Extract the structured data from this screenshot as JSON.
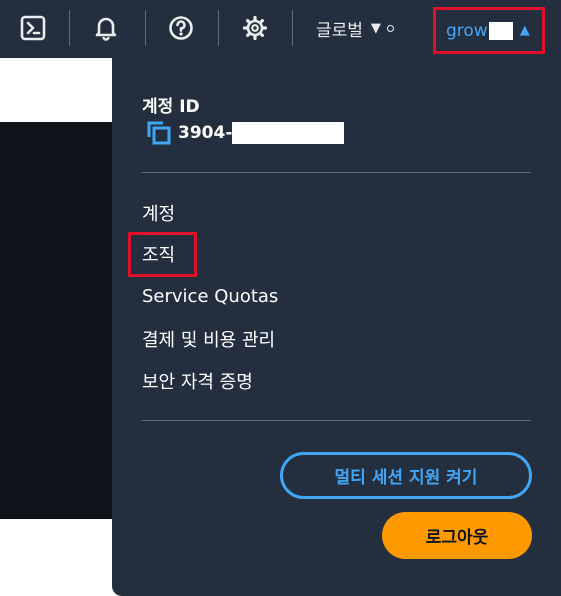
{
  "topnav": {
    "icons": [
      "cloudshell-icon",
      "bell-icon",
      "help-icon",
      "gear-icon"
    ],
    "region_label": "글로벌",
    "account_username": "grow"
  },
  "account_menu": {
    "id_heading": "계정 ID",
    "account_id_prefix": "3904-",
    "items": [
      "계정",
      "조직",
      "Service Quotas",
      "결제 및 비용 관리",
      "보안 자격 증명"
    ],
    "multi_session_button": "멀티 세션 지원 켜기",
    "sign_out_button": "로그아웃"
  },
  "colors": {
    "nav_background": "#232f3e",
    "link_blue": "#42a5f5",
    "signout_orange": "#ff9900",
    "highlight_red": "#e1102a"
  }
}
